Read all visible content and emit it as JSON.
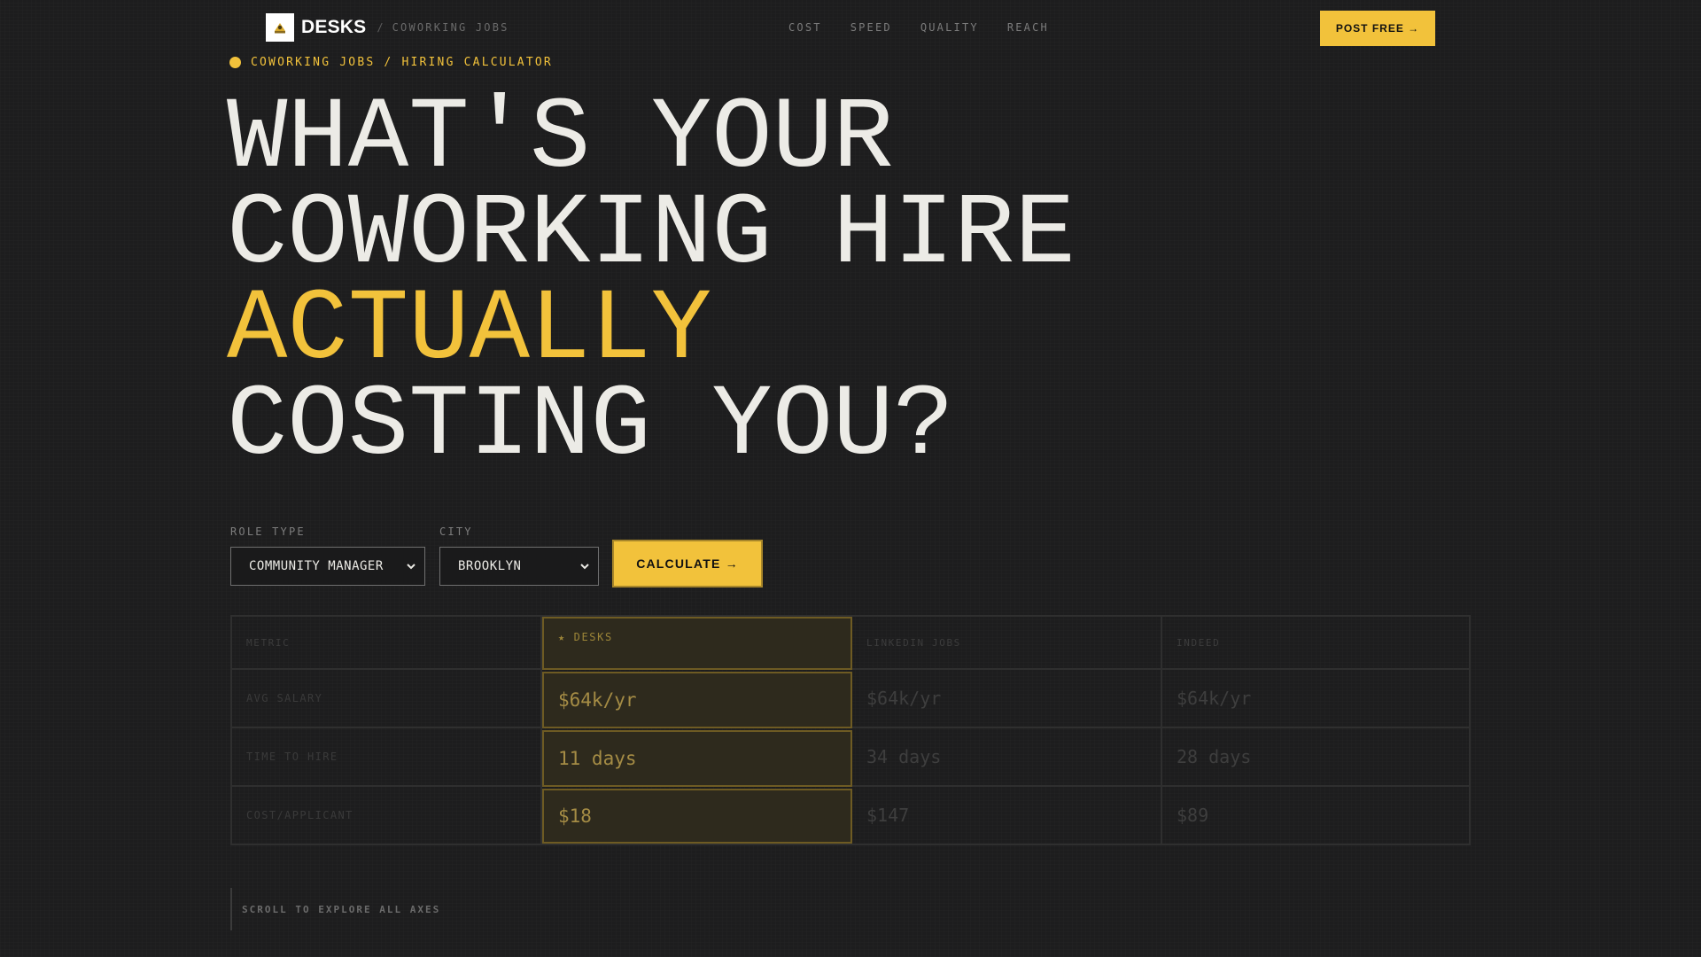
{
  "nav": {
    "logo_text": "DESKS",
    "separator": "/",
    "section": "COWORKING JOBS",
    "links": [
      {
        "label": "COST"
      },
      {
        "label": "SPEED"
      },
      {
        "label": "QUALITY"
      },
      {
        "label": "REACH"
      }
    ],
    "cta_label": "POST FREE →"
  },
  "eyebrow": {
    "text": "COWORKING JOBS / HIRING CALCULATOR"
  },
  "headline": {
    "line1": "WHAT'S YOUR",
    "line2": "COWORKING HIRE",
    "line3": "ACTUALLY",
    "line4": "COSTING YOU?"
  },
  "form": {
    "role_label": "ROLE TYPE",
    "role_value": "COMMUNITY MANAGER",
    "city_label": "CITY",
    "city_value": "BROOKLYN",
    "calculate_label": "CALCULATE →"
  },
  "table": {
    "headers": [
      "METRIC",
      "★ DESKS",
      "LINKEDIN JOBS",
      "INDEED"
    ],
    "rows": [
      {
        "metric": "AVG SALARY",
        "desks": "$64k/yr",
        "linkedin": "$64k/yr",
        "indeed": "$64k/yr"
      },
      {
        "metric": "TIME TO HIRE",
        "desks": "11 days",
        "linkedin": "34 days",
        "indeed": "28 days"
      },
      {
        "metric": "COST/APPLICANT",
        "desks": "$18",
        "linkedin": "$147",
        "indeed": "$89"
      }
    ]
  },
  "scroll_hint": "SCROLL TO EXPLORE ALL AXES",
  "colors": {
    "accent": "#f2c23b",
    "background": "#1d1d1e",
    "text": "#ecebe6"
  },
  "icons": {
    "logo": "desk-chair-icon",
    "dropdown": "chevron-down-icon",
    "eyebrow": "dot-icon"
  }
}
